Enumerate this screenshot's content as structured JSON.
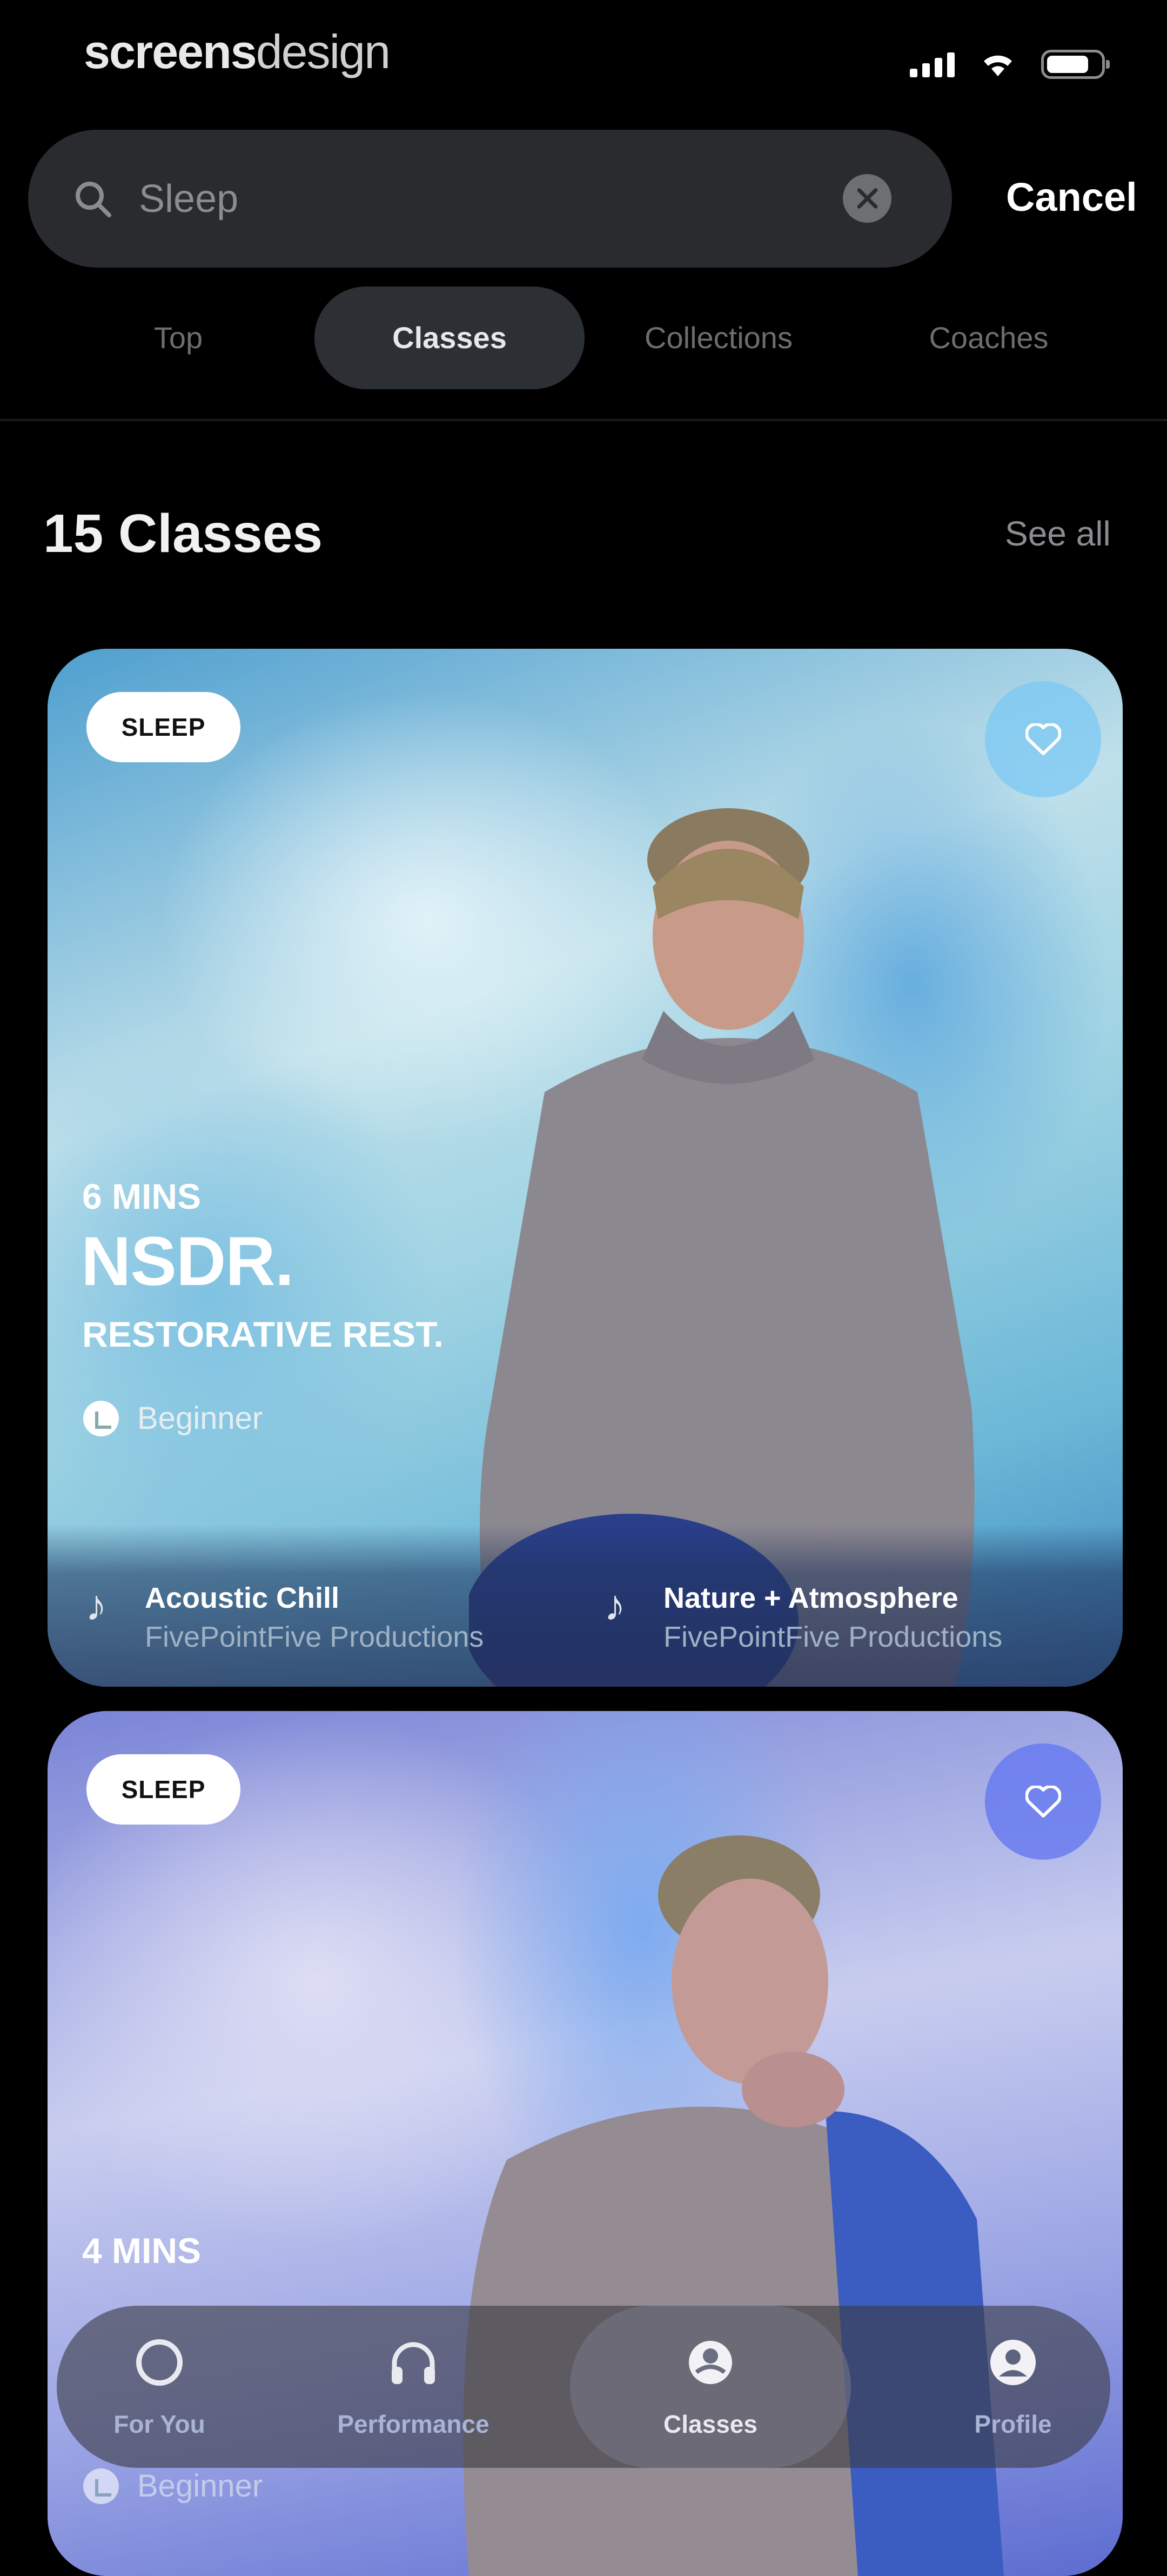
{
  "status_bar": {
    "brand_bold": "screens",
    "brand_light": "design"
  },
  "search": {
    "value": "Sleep",
    "cancel_label": "Cancel"
  },
  "tabs": [
    {
      "label": "Top",
      "active": false
    },
    {
      "label": "Classes",
      "active": true
    },
    {
      "label": "Collections",
      "active": false
    },
    {
      "label": "Coaches",
      "active": false
    }
  ],
  "results": {
    "count_label": "15 Classes",
    "see_all_label": "See all"
  },
  "cards": [
    {
      "badge": "SLEEP",
      "duration": "6 MINS",
      "title": "NSDR.",
      "subtitle": "RESTORATIVE REST.",
      "level": "Beginner",
      "tracks": [
        {
          "name": "Acoustic Chill",
          "by": "FivePointFive Productions"
        },
        {
          "name": "Nature + Atmosphere",
          "by": "FivePointFive Productions"
        }
      ]
    },
    {
      "badge": "SLEEP",
      "duration": "4 MINS",
      "level": "Beginner"
    }
  ],
  "bottom_nav": [
    {
      "label": "For You",
      "icon": "circle-icon",
      "active": false
    },
    {
      "label": "Performance",
      "icon": "headphones-icon",
      "active": false
    },
    {
      "label": "Classes",
      "icon": "classes-icon",
      "active": true
    },
    {
      "label": "Profile",
      "icon": "profile-icon",
      "active": false
    }
  ],
  "colors": {
    "background": "#000000",
    "search_bg": "#2a2b2e",
    "active_tab_bg": "#2c3035",
    "nav_label": "#a9b3d6"
  }
}
